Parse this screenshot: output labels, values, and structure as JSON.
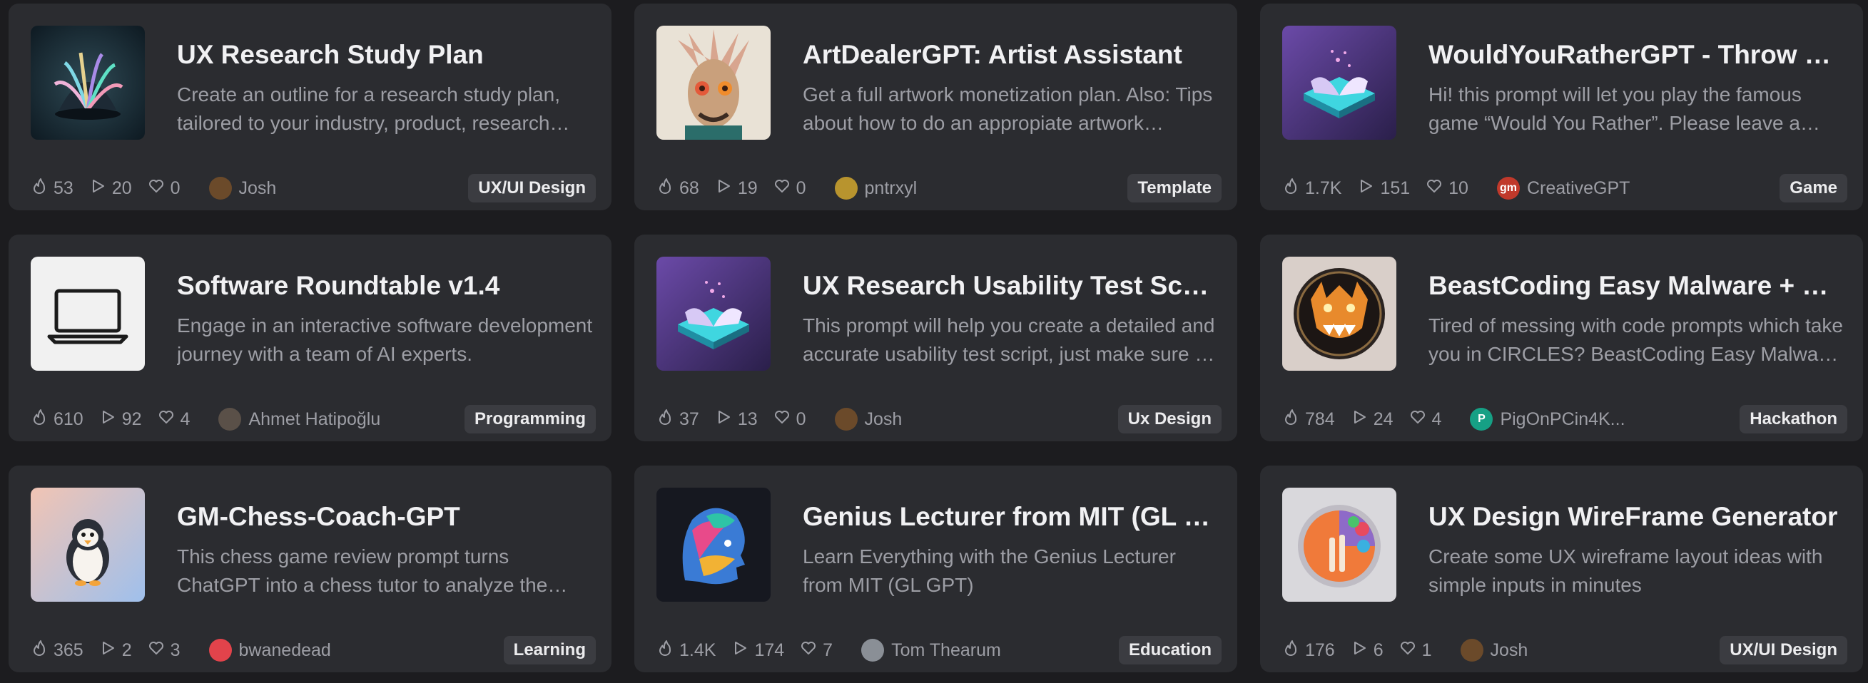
{
  "cards": [
    {
      "title": "UX Research Study Plan",
      "desc": "Create an outline for a research study plan, tailored to your industry, product, research goals and users.",
      "views": "53",
      "runs": "20",
      "likes": "0",
      "author": "Josh",
      "tag": "UX/UI Design",
      "thumb": "book-neon-icon",
      "avatar_color": "#6b4a2a",
      "avatar_text": ""
    },
    {
      "title": "ArtDealerGPT: Artist Assistant",
      "desc": "Get a full artwork monetization plan. Also: Tips about how to do an appropiate artwork presentation.",
      "views": "68",
      "runs": "19",
      "likes": "0",
      "author": "pntrxyl",
      "tag": "Template",
      "thumb": "cyborg-portrait-icon",
      "avatar_color": "#b8942e",
      "avatar_text": ""
    },
    {
      "title": "WouldYouRatherGPT - Throw Up or Stay?",
      "desc": "Hi! this prompt will let you play the famous game “Would You Rather”. Please leave a comment.",
      "views": "1.7K",
      "runs": "151",
      "likes": "10",
      "author": "CreativeGPT",
      "tag": "Game",
      "thumb": "book-purple-icon",
      "avatar_color": "#c0392b",
      "avatar_text": "gm"
    },
    {
      "title": "Software Roundtable v1.4",
      "desc": "Engage in an interactive software development journey with a team of AI experts.",
      "views": "610",
      "runs": "92",
      "likes": "4",
      "author": "Ahmet Hatipoğlu",
      "tag": "Programming",
      "thumb": "laptop-icon",
      "avatar_color": "#5a5048",
      "avatar_text": ""
    },
    {
      "title": "UX Research Usability Test Script",
      "desc": "This prompt will help you create a detailed and accurate usability test script, just make sure to fill in the blanks.",
      "views": "37",
      "runs": "13",
      "likes": "0",
      "author": "Josh",
      "tag": "Ux Design",
      "thumb": "book-purple-icon",
      "avatar_color": "#6b4a2a",
      "avatar_text": ""
    },
    {
      "title": "BeastCoding Easy Malware + Obfuscation",
      "desc": "Tired of messing with code prompts which take you in CIRCLES? BeastCoding Easy Malware is here.",
      "views": "784",
      "runs": "24",
      "likes": "4",
      "author": "PigOnPCin4K...",
      "tag": "Hackathon",
      "thumb": "beast-icon",
      "avatar_color": "#16a085",
      "avatar_text": "P"
    },
    {
      "title": "GM-Chess-Coach-GPT",
      "desc": "This chess game review prompt turns ChatGPT into a chess tutor to analyze the game you played.",
      "views": "365",
      "runs": "2",
      "likes": "3",
      "author": "bwanedead",
      "tag": "Learning",
      "thumb": "penguin-icon",
      "avatar_color": "#e2434b",
      "avatar_text": ""
    },
    {
      "title": "Genius Lecturer from MIT (GL GPT)",
      "desc": "Learn Everything with the Genius Lecturer from MIT (GL GPT)",
      "views": "1.4K",
      "runs": "174",
      "likes": "7",
      "author": "Tom Thearum",
      "tag": "Education",
      "thumb": "colorful-face-icon",
      "avatar_color": "#8a8f96",
      "avatar_text": ""
    },
    {
      "title": "UX Design WireFrame Generator",
      "desc": "Create some UX wireframe layout ideas with simple inputs in minutes",
      "views": "176",
      "runs": "6",
      "likes": "1",
      "author": "Josh",
      "tag": "UX/UI Design",
      "thumb": "palette-icon",
      "avatar_color": "#6b4a2a",
      "avatar_text": ""
    }
  ]
}
